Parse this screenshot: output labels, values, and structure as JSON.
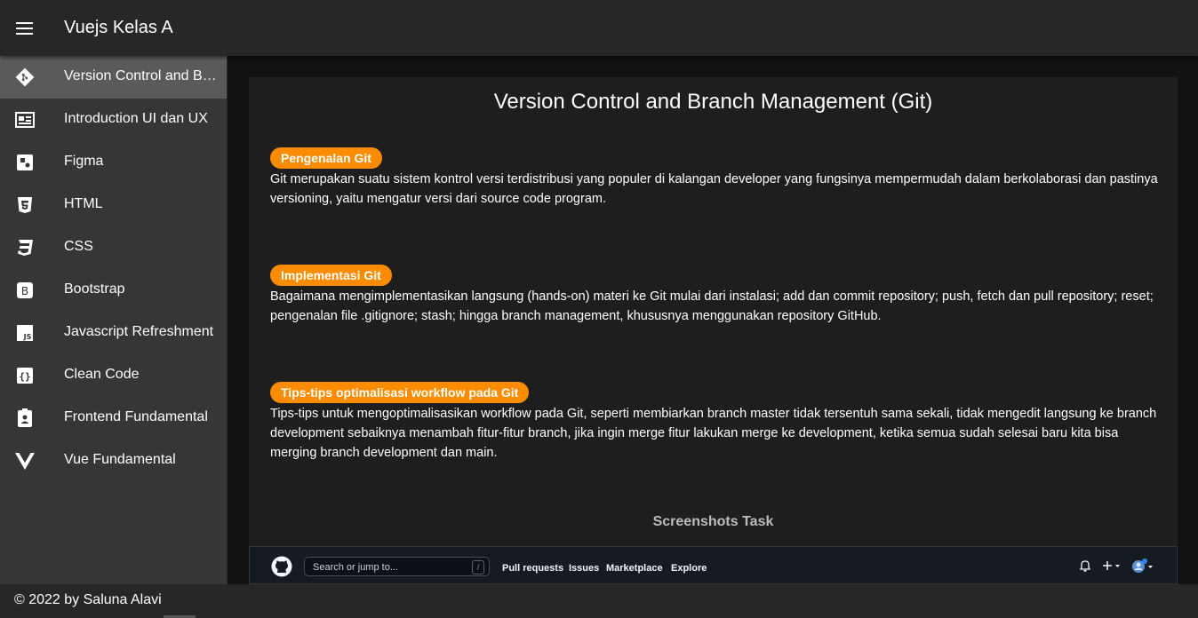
{
  "app": {
    "title": "Vuejs Kelas A"
  },
  "sidebar": {
    "items": [
      {
        "label": "Version Control and Branch Management (Git)",
        "icon": "git-icon",
        "active": true
      },
      {
        "label": "Introduction UI dan UX",
        "icon": "newspaper-icon"
      },
      {
        "label": "Figma",
        "icon": "figma-icon"
      },
      {
        "label": "HTML",
        "icon": "html5-icon"
      },
      {
        "label": "CSS",
        "icon": "css3-icon"
      },
      {
        "label": "Bootstrap",
        "icon": "bootstrap-icon"
      },
      {
        "label": "Javascript Refreshment",
        "icon": "javascript-icon"
      },
      {
        "label": "Clean Code",
        "icon": "code-braces-icon"
      },
      {
        "label": "Frontend Fundamental",
        "icon": "badge-account-icon"
      },
      {
        "label": "Vue Fundamental",
        "icon": "vuejs-icon"
      }
    ]
  },
  "main": {
    "title": "Version Control and Branch Management (Git)",
    "sections": [
      {
        "badge": "Pengenalan Git",
        "text": "Git merupakan suatu sistem kontrol versi terdistribusi yang populer di kalangan developer yang fungsinya mempermudah dalam berkolaborasi dan pastinya versioning, yaitu mengatur versi dari source code program."
      },
      {
        "badge": "Implementasi Git",
        "text": "Bagaimana mengimplementasikan langsung (hands-on) materi ke Git mulai dari instalasi; add dan commit repository; push, fetch dan pull repository; reset; pengenalan file .gitignore; stash; hingga branch management, khususnya menggunakan repository GitHub."
      },
      {
        "badge": "Tips-tips optimalisasi workflow pada Git",
        "text": "Tips-tips untuk mengoptimalisasikan workflow pada Git, seperti membiarkan branch master tidak tersentuh sama sekali, tidak mengedit langsung ke branch development sebaiknya menambah fitur-fitur branch, jika ingin merge fitur lakukan merge ke development, ketika semua sudah selesai baru kita bisa merging branch development dan main."
      }
    ],
    "screenshots_title": "Screenshots Task"
  },
  "github": {
    "search_placeholder": "Search or jump to...",
    "slash": "/",
    "nav": [
      "Pull requests",
      "Issues",
      "Marketplace",
      "Explore"
    ]
  },
  "footer": {
    "text": "© 2022 by Saluna Alavi"
  },
  "colors": {
    "accent": "#fb8c00",
    "appbar": "#272727",
    "sidebar": "#363636",
    "active": "#5a5a5a"
  }
}
